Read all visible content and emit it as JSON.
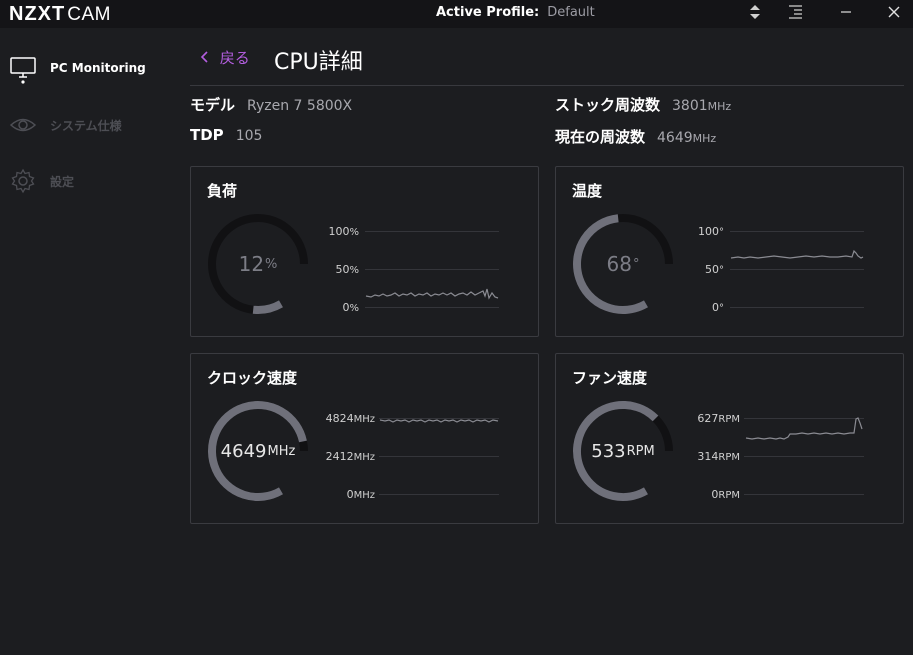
{
  "topbar": {
    "brand": "NZXT",
    "product": "CAM",
    "profile_label": "Active Profile:",
    "profile_value": "Default"
  },
  "sidebar": {
    "items": [
      {
        "label": "PC Monitoring",
        "icon": "monitor-icon",
        "active": true
      },
      {
        "label": "システム仕様",
        "icon": "eye-icon",
        "active": false
      },
      {
        "label": "設定",
        "icon": "gear-icon",
        "active": false
      }
    ]
  },
  "header": {
    "back_label": "戻る",
    "title": "CPU詳細"
  },
  "specs": {
    "model_label": "モデル",
    "model_value": "Ryzen 7 5800X",
    "tdp_label": "TDP",
    "tdp_value": "105",
    "stock_label": "ストック周波数",
    "stock_value": "3801",
    "stock_unit": "MHz",
    "current_label": "現在の周波数",
    "current_value": "4649",
    "current_unit": "MHz"
  },
  "colors": {
    "accent": "#b45ee0",
    "gauge_fill": "#6f707a",
    "gauge_track": "#111113",
    "graph_line": "#8a8b92"
  },
  "cards": {
    "load": {
      "title": "負荷",
      "value": "12",
      "unit": "%",
      "fraction": 0.12,
      "ticks": [
        {
          "value": "100",
          "unit": "%"
        },
        {
          "value": "50",
          "unit": "%"
        },
        {
          "value": "0",
          "unit": "%"
        }
      ]
    },
    "temp": {
      "title": "温度",
      "value": "68",
      "unit": "°",
      "fraction": 0.68,
      "ticks": [
        {
          "value": "100",
          "unit": "°"
        },
        {
          "value": "50",
          "unit": "°"
        },
        {
          "value": "0",
          "unit": "°"
        }
      ]
    },
    "clock": {
      "title": "クロック速度",
      "value": "4649",
      "unit": "MHz",
      "fraction": 0.96,
      "ticks": [
        {
          "value": "4824",
          "unit": "MHz"
        },
        {
          "value": "2412",
          "unit": "MHz"
        },
        {
          "value": "0",
          "unit": "MHz"
        }
      ]
    },
    "fan": {
      "title": "ファン速度",
      "value": "533",
      "unit": "RPM",
      "fraction": 0.85,
      "ticks": [
        {
          "value": "627",
          "unit": "RPM"
        },
        {
          "value": "314",
          "unit": "RPM"
        },
        {
          "value": "0",
          "unit": "RPM"
        }
      ]
    }
  }
}
